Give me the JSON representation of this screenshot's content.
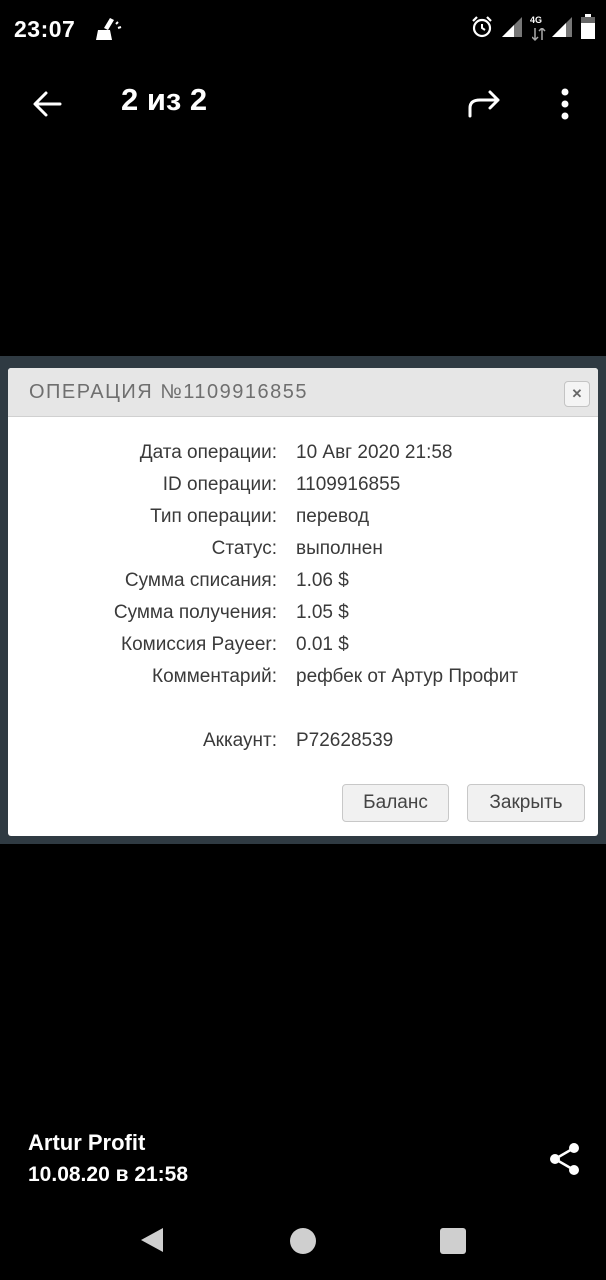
{
  "status_bar": {
    "time": "23:07",
    "network_label": "4G",
    "icons": [
      "cleaner-icon",
      "alarm-icon",
      "signal-icon",
      "signal-4g-icon",
      "signal-icon",
      "battery-icon"
    ]
  },
  "viewer": {
    "counter": "2 из 2",
    "icons": [
      "back-arrow-icon",
      "forward-icon",
      "more-vert-icon"
    ]
  },
  "dialog": {
    "title": "ОПЕРАЦИЯ №1109916855",
    "close_glyph": "✕",
    "rows": [
      {
        "label": "Дата операции:",
        "value": "10 Авг 2020 21:58"
      },
      {
        "label": "ID операции:",
        "value": "1109916855"
      },
      {
        "label": "Тип операции:",
        "value": "перевод"
      },
      {
        "label": "Статус:",
        "value": "выполнен"
      },
      {
        "label": "Сумма списания:",
        "value": "1.06 $"
      },
      {
        "label": "Сумма получения:",
        "value": "1.05 $"
      },
      {
        "label": "Комиссия Payeer:",
        "value": "0.01 $"
      },
      {
        "label": "Комментарий:",
        "value": "рефбек от Артур Профит"
      },
      {
        "label": "Аккаунт:",
        "value": "P72628539"
      }
    ],
    "buttons": {
      "balance": "Баланс",
      "close": "Закрыть"
    }
  },
  "footer": {
    "sender": "Artur Profit",
    "datetime": "10.08.20 в 21:58"
  },
  "colors": {
    "background": "#000000",
    "frame": "#2f3a42",
    "dialog_header": "#e6e6e6",
    "dialog_text": "#3a3a3a"
  }
}
